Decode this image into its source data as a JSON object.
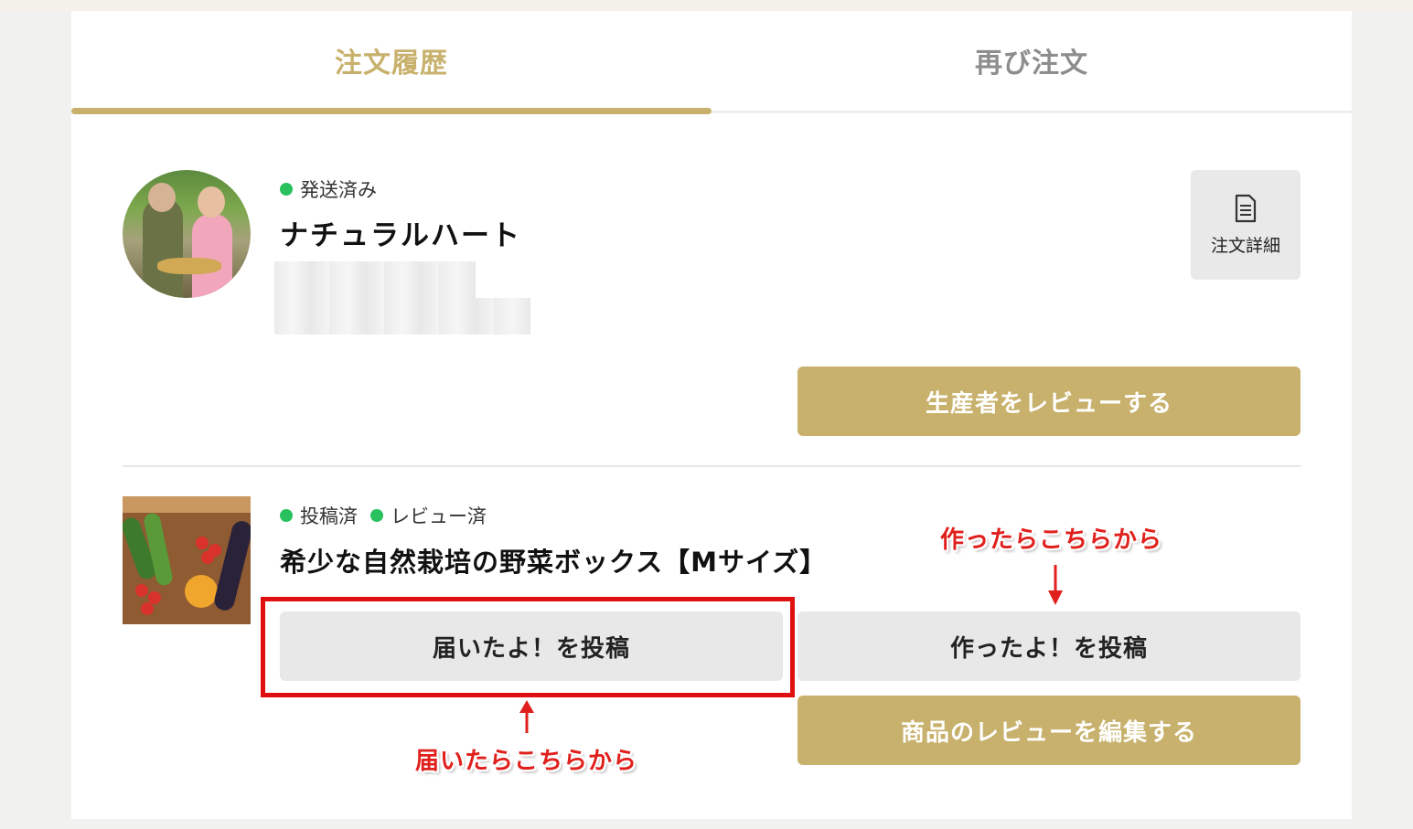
{
  "tabs": [
    {
      "label": "注文履歴",
      "active": true
    },
    {
      "label": "再び注文",
      "active": false
    }
  ],
  "order": {
    "status": "発送済み",
    "producer_name": "ナチュラルハート",
    "detail_button": {
      "label": "注文詳細",
      "icon": "document-icon"
    },
    "review_producer_button": "生産者をレビューする"
  },
  "product": {
    "statuses": [
      "投稿済",
      "レビュー済"
    ],
    "name": "希少な自然栽培の野菜ボックス【Mサイズ】",
    "received_post_button": "届いたよ！を投稿",
    "made_post_button": "作ったよ！を投稿",
    "edit_review_button": "商品のレビューを編集する"
  },
  "annotations": {
    "made_hint": "作ったらこちらから",
    "received_hint": "届いたらこちらから"
  },
  "colors": {
    "accent": "#c8b16c",
    "status_dot": "#29c15e",
    "annotation_red": "#e01010"
  }
}
